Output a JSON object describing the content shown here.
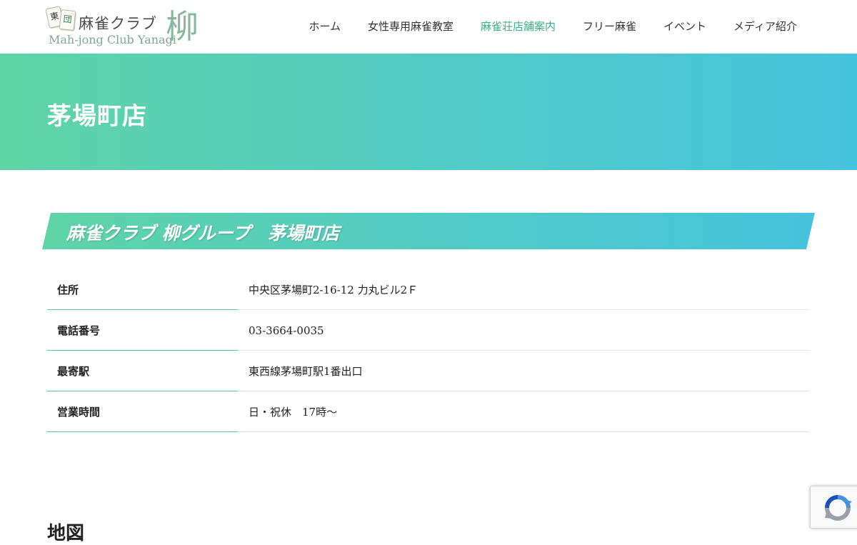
{
  "logo": {
    "tile1": "東",
    "tile2": "団",
    "title_jp": "麻雀クラブ",
    "title_en": "Mah-jong Club Yanagi",
    "kanji": "柳"
  },
  "nav": {
    "items": [
      {
        "label": "ホーム"
      },
      {
        "label": "女性専用麻雀教室"
      },
      {
        "label": "麻雀荘店舗案内"
      },
      {
        "label": "フリー麻雀"
      },
      {
        "label": "イベント"
      },
      {
        "label": "メディア紹介"
      }
    ],
    "active_index": 2
  },
  "hero": {
    "title": "茅場町店"
  },
  "banner": {
    "title": "麻雀クラブ 柳グループ　茅場町店"
  },
  "info": {
    "rows": [
      {
        "label": "住所",
        "value": "中央区茅場町2-16-12 力丸ビル2Ｆ"
      },
      {
        "label": "電話番号",
        "value": "03-3664-0035"
      },
      {
        "label": "最寄駅",
        "value": "東西線茅場町駅1番出口"
      },
      {
        "label": "営業時間",
        "value": "日・祝休　17時〜"
      }
    ]
  },
  "map": {
    "heading": "地図"
  },
  "colors": {
    "accent": "#3fae8a",
    "gradient_start": "#5fd4a6",
    "gradient_end": "#46c3dc"
  },
  "icons": {
    "recaptcha": "recaptcha-icon"
  }
}
